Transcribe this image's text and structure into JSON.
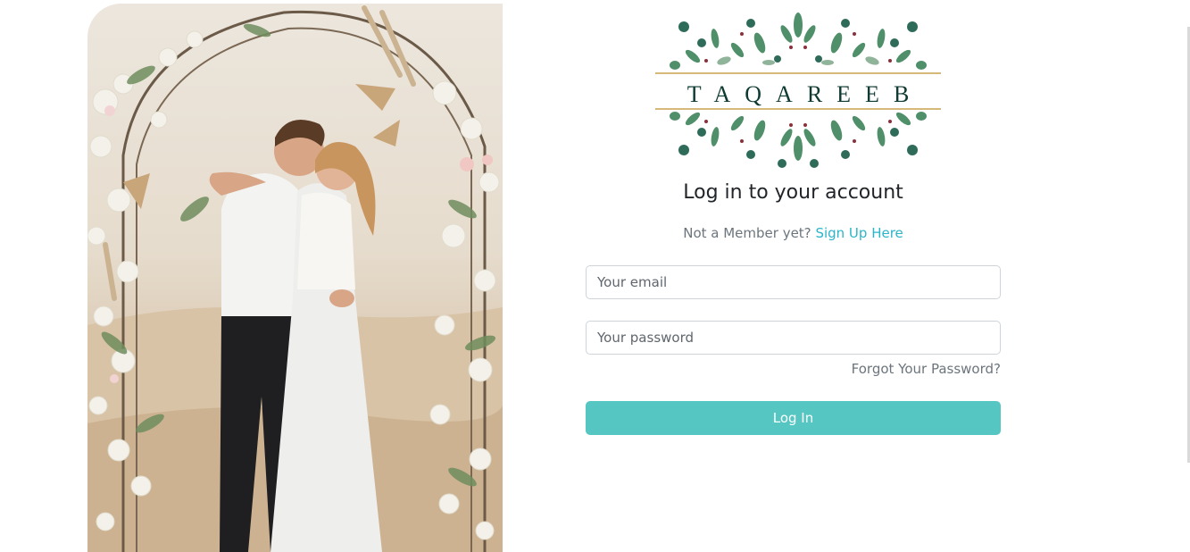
{
  "logo": {
    "wordmark": "TAQAREEB"
  },
  "login": {
    "title": "Log in to your account",
    "signup_prompt": "Not a Member yet?",
    "signup_link": "Sign Up Here",
    "email_placeholder": "Your email",
    "password_placeholder": "Your password",
    "forgot_password": "Forgot Your Password?",
    "submit_label": "Log In"
  },
  "colors": {
    "accent": "#55c6c2",
    "link": "#2bb5c9",
    "logo_text": "#0f3b32",
    "logo_rule": "#c9a04e",
    "leaf": "#4f8f6a"
  }
}
